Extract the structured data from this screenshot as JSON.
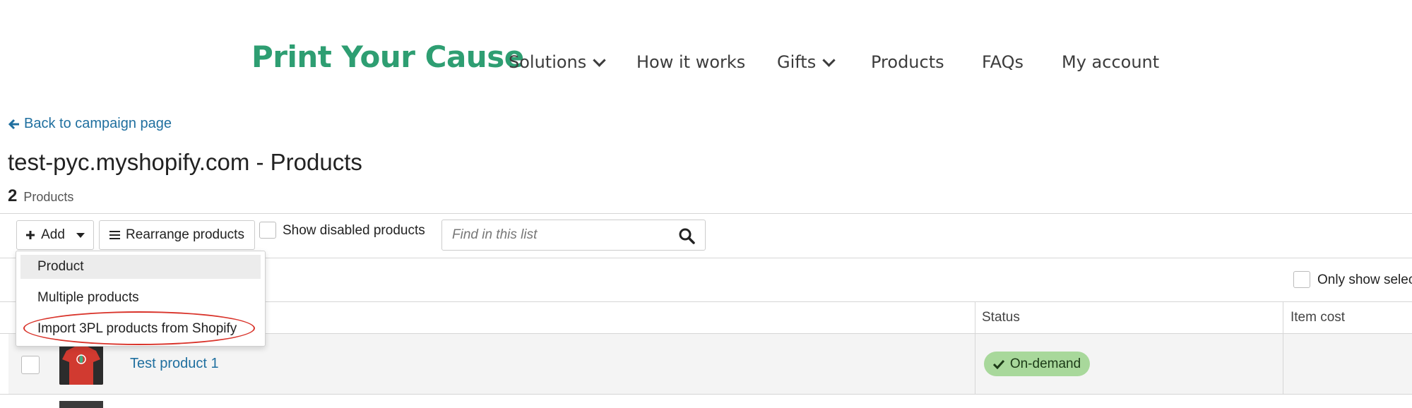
{
  "header": {
    "logo": "Print Your Cause",
    "nav": [
      {
        "label": "Solutions",
        "dropdown": true
      },
      {
        "label": "How it works",
        "dropdown": false
      },
      {
        "label": "Gifts",
        "dropdown": true
      },
      {
        "label": "Products",
        "dropdown": false
      },
      {
        "label": "FAQs",
        "dropdown": false
      },
      {
        "label": "My account",
        "dropdown": false
      }
    ]
  },
  "back_link": "Back to campaign page",
  "page_title": "test-pyc.myshopify.com - Products",
  "product_count": {
    "number": "2",
    "label": "Products"
  },
  "toolbar": {
    "add_label": "Add",
    "rearrange_label": "Rearrange products",
    "show_disabled_label": "Show disabled products",
    "search_placeholder": "Find in this list"
  },
  "add_menu": {
    "items": [
      "Product",
      "Multiple products",
      "Import 3PL products from Shopify"
    ],
    "highlighted_index": 0,
    "circled_index": 2
  },
  "only_show_label": "Only show selec",
  "table": {
    "columns": [
      "Status",
      "Item cost"
    ],
    "rows": [
      {
        "name": "Test product 1",
        "status": "On-demand"
      }
    ]
  },
  "colors": {
    "brand": "#2e9e72",
    "link": "#1f6f9f",
    "status_ondemand": "#a8d89b",
    "annotation": "#d9342b"
  }
}
